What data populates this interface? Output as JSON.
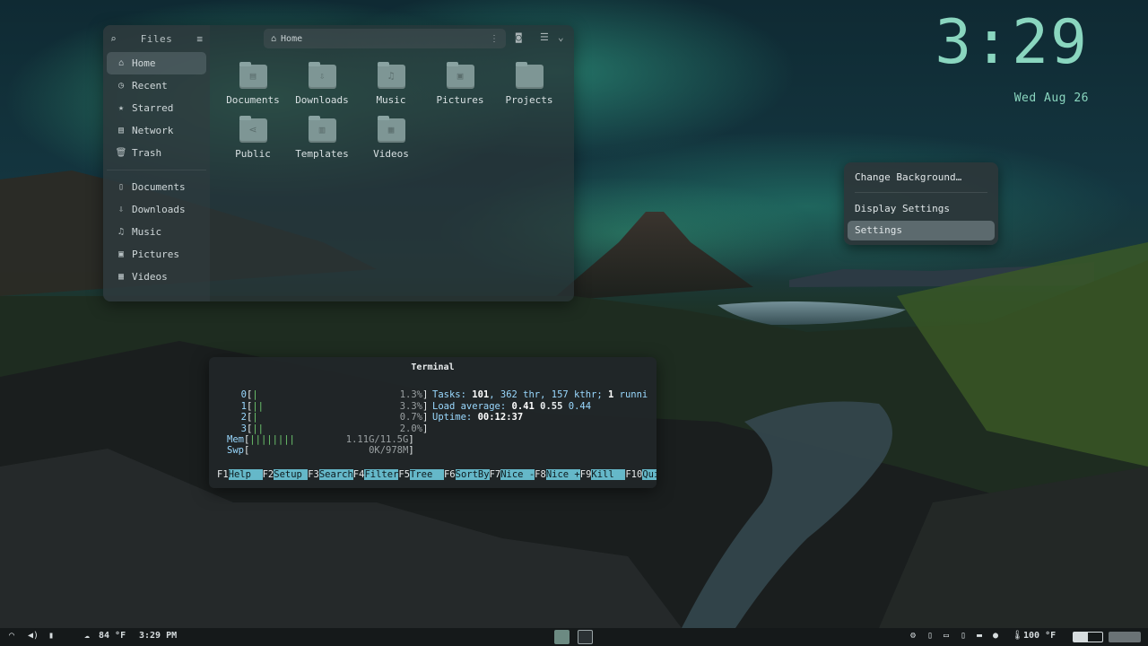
{
  "files": {
    "sidebar_title": "Files",
    "path": "Home",
    "sidebar": [
      {
        "label": "Home",
        "icon": "home-icon",
        "glyph": "⌂",
        "active": true
      },
      {
        "label": "Recent",
        "icon": "clock-icon",
        "glyph": "◷"
      },
      {
        "label": "Starred",
        "icon": "star-icon",
        "glyph": "★"
      },
      {
        "label": "Network",
        "icon": "network-icon",
        "glyph": "▤"
      },
      {
        "label": "Trash",
        "icon": "trash-icon",
        "glyph": "🗑"
      }
    ],
    "bookmarks": [
      {
        "label": "Documents",
        "icon": "document-icon",
        "glyph": "▯"
      },
      {
        "label": "Downloads",
        "icon": "download-icon",
        "glyph": "⇩"
      },
      {
        "label": "Music",
        "icon": "music-icon",
        "glyph": "♫"
      },
      {
        "label": "Pictures",
        "icon": "picture-icon",
        "glyph": "▣"
      },
      {
        "label": "Videos",
        "icon": "video-icon",
        "glyph": "▦"
      }
    ],
    "folders": [
      {
        "label": "Documents",
        "glyph": "▤"
      },
      {
        "label": "Downloads",
        "glyph": "⇩"
      },
      {
        "label": "Music",
        "glyph": "♫"
      },
      {
        "label": "Pictures",
        "glyph": "▣"
      },
      {
        "label": "Projects",
        "glyph": ""
      },
      {
        "label": "Public",
        "glyph": "⋖"
      },
      {
        "label": "Templates",
        "glyph": "▥"
      },
      {
        "label": "Videos",
        "glyph": "▦"
      }
    ]
  },
  "clock": {
    "time": "3:29",
    "date": "Wed Aug 26"
  },
  "context_menu": {
    "items": [
      "Change Background…",
      "Display Settings",
      "Settings"
    ]
  },
  "terminal": {
    "title": "Terminal",
    "cpus": [
      {
        "num": "0",
        "bar": "|",
        "pct": "1.3%"
      },
      {
        "num": "1",
        "bar": "||",
        "pct": "3.3%"
      },
      {
        "num": "2",
        "bar": "|",
        "pct": "0.7%"
      },
      {
        "num": "3",
        "bar": "||",
        "pct": "2.0%"
      }
    ],
    "mem": {
      "label": "Mem",
      "bar": "||||||||",
      "value": "1.11G/11.5G"
    },
    "swp": {
      "label": "Swp",
      "value": "0K/978M"
    },
    "tasks": {
      "label": "Tasks:",
      "count": "101",
      "thr": ", 362 thr, 157 kthr; ",
      "running": "1",
      "running_label": " runni"
    },
    "load": {
      "label": "Load average:",
      "v1": "0.41",
      "v2": "0.55",
      "v3": "0.44"
    },
    "uptime": {
      "label": "Uptime:",
      "value": "00:12:37"
    },
    "fkeys": [
      {
        "key": "F1",
        "label": "Help  "
      },
      {
        "key": "F2",
        "label": "Setup "
      },
      {
        "key": "F3",
        "label": "Search"
      },
      {
        "key": "F4",
        "label": "Filter"
      },
      {
        "key": "F5",
        "label": "Tree  "
      },
      {
        "key": "F6",
        "label": "SortBy"
      },
      {
        "key": "F7",
        "label": "Nice -"
      },
      {
        "key": "F8",
        "label": "Nice +"
      },
      {
        "key": "F9",
        "label": "Kill  "
      },
      {
        "key": "F10",
        "label": "Quit  "
      }
    ]
  },
  "taskbar": {
    "weather": "84 °F",
    "time": "3:29 PM",
    "temp": "100 °F"
  }
}
